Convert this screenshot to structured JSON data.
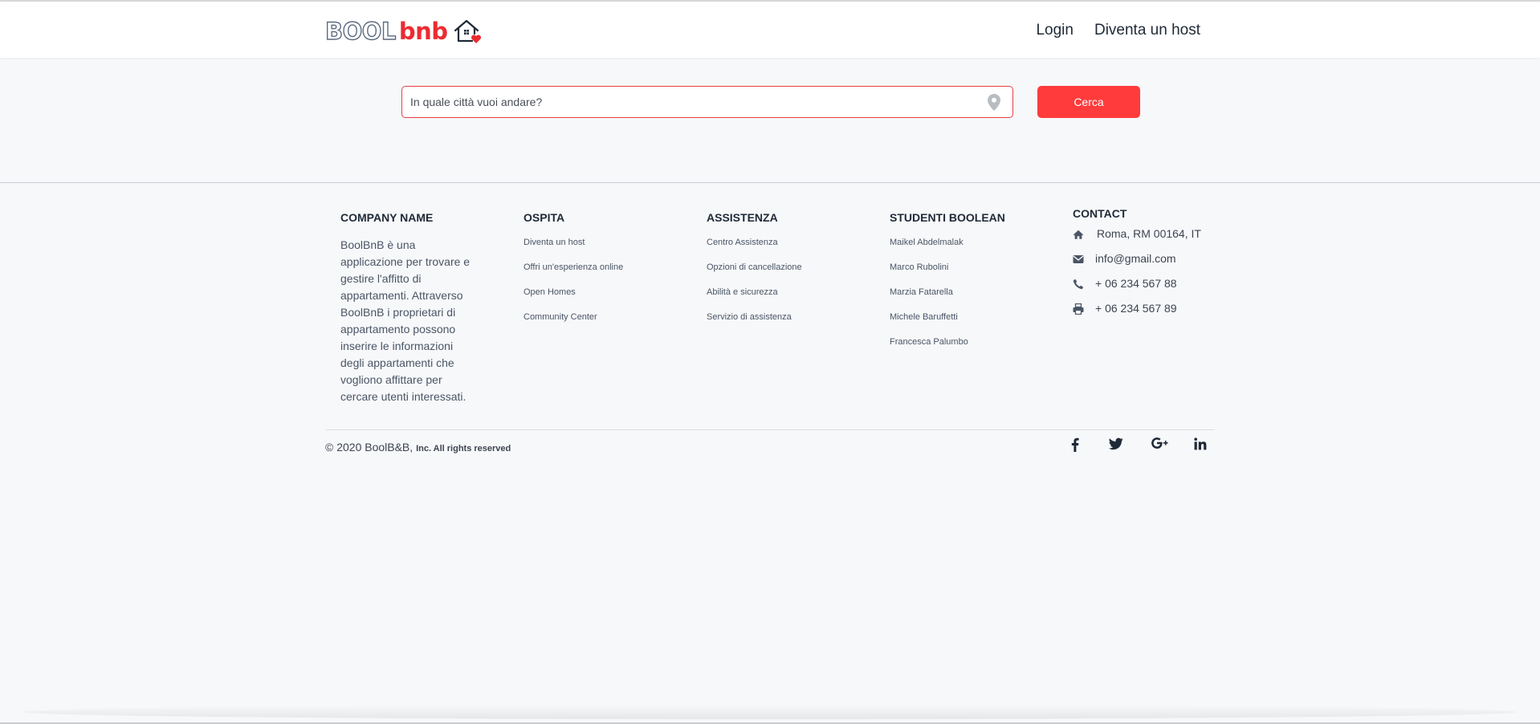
{
  "header": {
    "logo": {
      "part1": "BOOL",
      "part2": "bnb"
    },
    "nav": [
      {
        "label": "Login"
      },
      {
        "label": "Diventa un host"
      }
    ]
  },
  "search": {
    "placeholder": "In quale città vuoi andare?",
    "button_label": "Cerca",
    "pin_icon": "map-marker-icon"
  },
  "footer": {
    "company": {
      "title": "COMPANY NAME",
      "description": "BoolBnB è una applicazione per trovare e gestire l'affitto di appartamenti. Attraverso BoolBnB i proprietari di appartamento possono inserire le informazioni degli appartamenti che vogliono affittare per cercare utenti interessati."
    },
    "ospita": {
      "title": "OSPITA",
      "items": [
        "Diventa un host",
        "Offri un'esperienza online",
        "Open Homes",
        "Community Center"
      ]
    },
    "assistenza": {
      "title": "ASSISTENZA",
      "items": [
        "Centro Assistenza",
        "Opzioni di cancellazione",
        "Abilità e sicurezza",
        "Servizio di assistenza"
      ]
    },
    "studenti": {
      "title": "STUDENTI BOOLEAN",
      "items": [
        "Maikel Abdelmalak",
        "Marco Rubolini",
        "Marzia Fatarella",
        "Michele Baruffetti",
        "Francesca Palumbo"
      ]
    },
    "contact": {
      "title": "CONTACT",
      "items": [
        {
          "icon": "home-icon",
          "text": "Roma, RM 00164, IT"
        },
        {
          "icon": "envelope-icon",
          "text": "info@gmail.com"
        },
        {
          "icon": "phone-icon",
          "text": "+ 06 234 567 88"
        },
        {
          "icon": "print-icon",
          "text": "+ 06 234 567 89"
        }
      ]
    },
    "copyright": {
      "main": "© 2020 BoolB&B,",
      "small": "Inc. All rights reserved"
    },
    "social": [
      "facebook-icon",
      "twitter-icon",
      "google-plus-icon",
      "linkedin-icon"
    ]
  },
  "colors": {
    "accent": "#ff3b3b",
    "logo_outline": "#5c6b80",
    "background": "#f7f8fa",
    "header_bg": "#ffffff"
  }
}
